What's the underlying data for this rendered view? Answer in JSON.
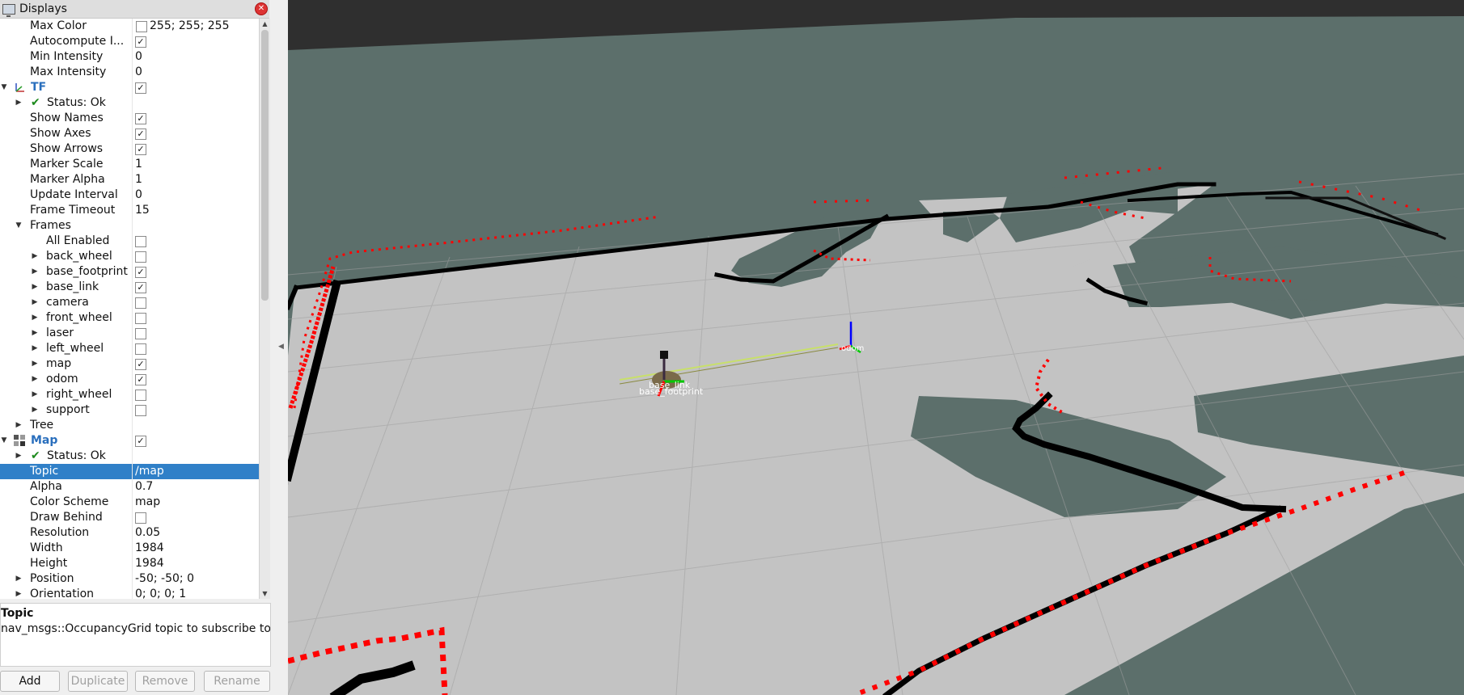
{
  "panel": {
    "title": "Displays",
    "close_icon": "close-icon",
    "rows": [
      {
        "label": "Max Color",
        "value": "255; 255; 255",
        "swatch": "#ffffff",
        "indent": 0
      },
      {
        "label": "Autocompute I...",
        "checked": true,
        "indent": 0
      },
      {
        "label": "Min Intensity",
        "value": "0",
        "indent": 0
      },
      {
        "label": "Max Intensity",
        "value": "0",
        "indent": 0
      },
      {
        "label": "TF",
        "group": true,
        "expanded": true,
        "checked": true,
        "icon": "tf-axes-icon"
      },
      {
        "label": "Status: Ok",
        "status": true,
        "indent": 0
      },
      {
        "label": "Show Names",
        "checked": true,
        "indent": 0
      },
      {
        "label": "Show Axes",
        "checked": true,
        "indent": 0
      },
      {
        "label": "Show Arrows",
        "checked": true,
        "indent": 0
      },
      {
        "label": "Marker Scale",
        "value": "1",
        "indent": 0
      },
      {
        "label": "Marker Alpha",
        "value": "1",
        "indent": 0
      },
      {
        "label": "Update Interval",
        "value": "0",
        "indent": 0
      },
      {
        "label": "Frame Timeout",
        "value": "15",
        "indent": 0
      },
      {
        "label": "Frames",
        "expandable": true,
        "expanded": true,
        "indent": 0
      },
      {
        "label": "All Enabled",
        "checked": false,
        "indent": 1
      },
      {
        "label": "back_wheel",
        "checked": false,
        "expandable": true,
        "indent": 1
      },
      {
        "label": "base_footprint",
        "checked": true,
        "expandable": true,
        "indent": 1
      },
      {
        "label": "base_link",
        "checked": true,
        "expandable": true,
        "indent": 1
      },
      {
        "label": "camera",
        "checked": false,
        "expandable": true,
        "indent": 1
      },
      {
        "label": "front_wheel",
        "checked": false,
        "expandable": true,
        "indent": 1
      },
      {
        "label": "laser",
        "checked": false,
        "expandable": true,
        "indent": 1
      },
      {
        "label": "left_wheel",
        "checked": false,
        "expandable": true,
        "indent": 1
      },
      {
        "label": "map",
        "checked": true,
        "expandable": true,
        "indent": 1
      },
      {
        "label": "odom",
        "checked": true,
        "expandable": true,
        "indent": 1
      },
      {
        "label": "right_wheel",
        "checked": false,
        "expandable": true,
        "indent": 1
      },
      {
        "label": "support",
        "checked": false,
        "expandable": true,
        "indent": 1
      },
      {
        "label": "Tree",
        "expandable": true,
        "indent": 0
      },
      {
        "label": "Map",
        "group": true,
        "expanded": true,
        "checked": true,
        "icon": "map-grid-icon"
      },
      {
        "label": "Status: Ok",
        "status": true,
        "indent": 0
      },
      {
        "label": "Topic",
        "value": "/map",
        "selected": true,
        "indent": 0
      },
      {
        "label": "Alpha",
        "value": "0.7",
        "indent": 0
      },
      {
        "label": "Color Scheme",
        "value": "map",
        "indent": 0
      },
      {
        "label": "Draw Behind",
        "checked": false,
        "indent": 0
      },
      {
        "label": "Resolution",
        "value": "0.05",
        "indent": 0
      },
      {
        "label": "Width",
        "value": "1984",
        "indent": 0
      },
      {
        "label": "Height",
        "value": "1984",
        "indent": 0
      },
      {
        "label": "Position",
        "value": "-50; -50; 0",
        "expandable": true,
        "indent": 0
      },
      {
        "label": "Orientation",
        "value": "0; 0; 0; 1",
        "expandable": true,
        "indent": 0
      }
    ]
  },
  "description": {
    "title": "Topic",
    "text": "nav_msgs::OccupancyGrid topic to subscribe to."
  },
  "buttons": {
    "add": "Add",
    "duplicate": "Duplicate",
    "remove": "Remove",
    "rename": "Rename"
  },
  "viewport": {
    "frame_labels": {
      "odom": "odom",
      "base_link": "base_link",
      "base_footprint": "base_footprint"
    },
    "colors": {
      "background": "#2f2f2f",
      "unknown": "#5c6f6b",
      "free": "#c3c3c3",
      "occupied": "#000000",
      "laser": "#ff0000",
      "grid": "#a0a0a0",
      "selection": "#3080c8"
    }
  }
}
